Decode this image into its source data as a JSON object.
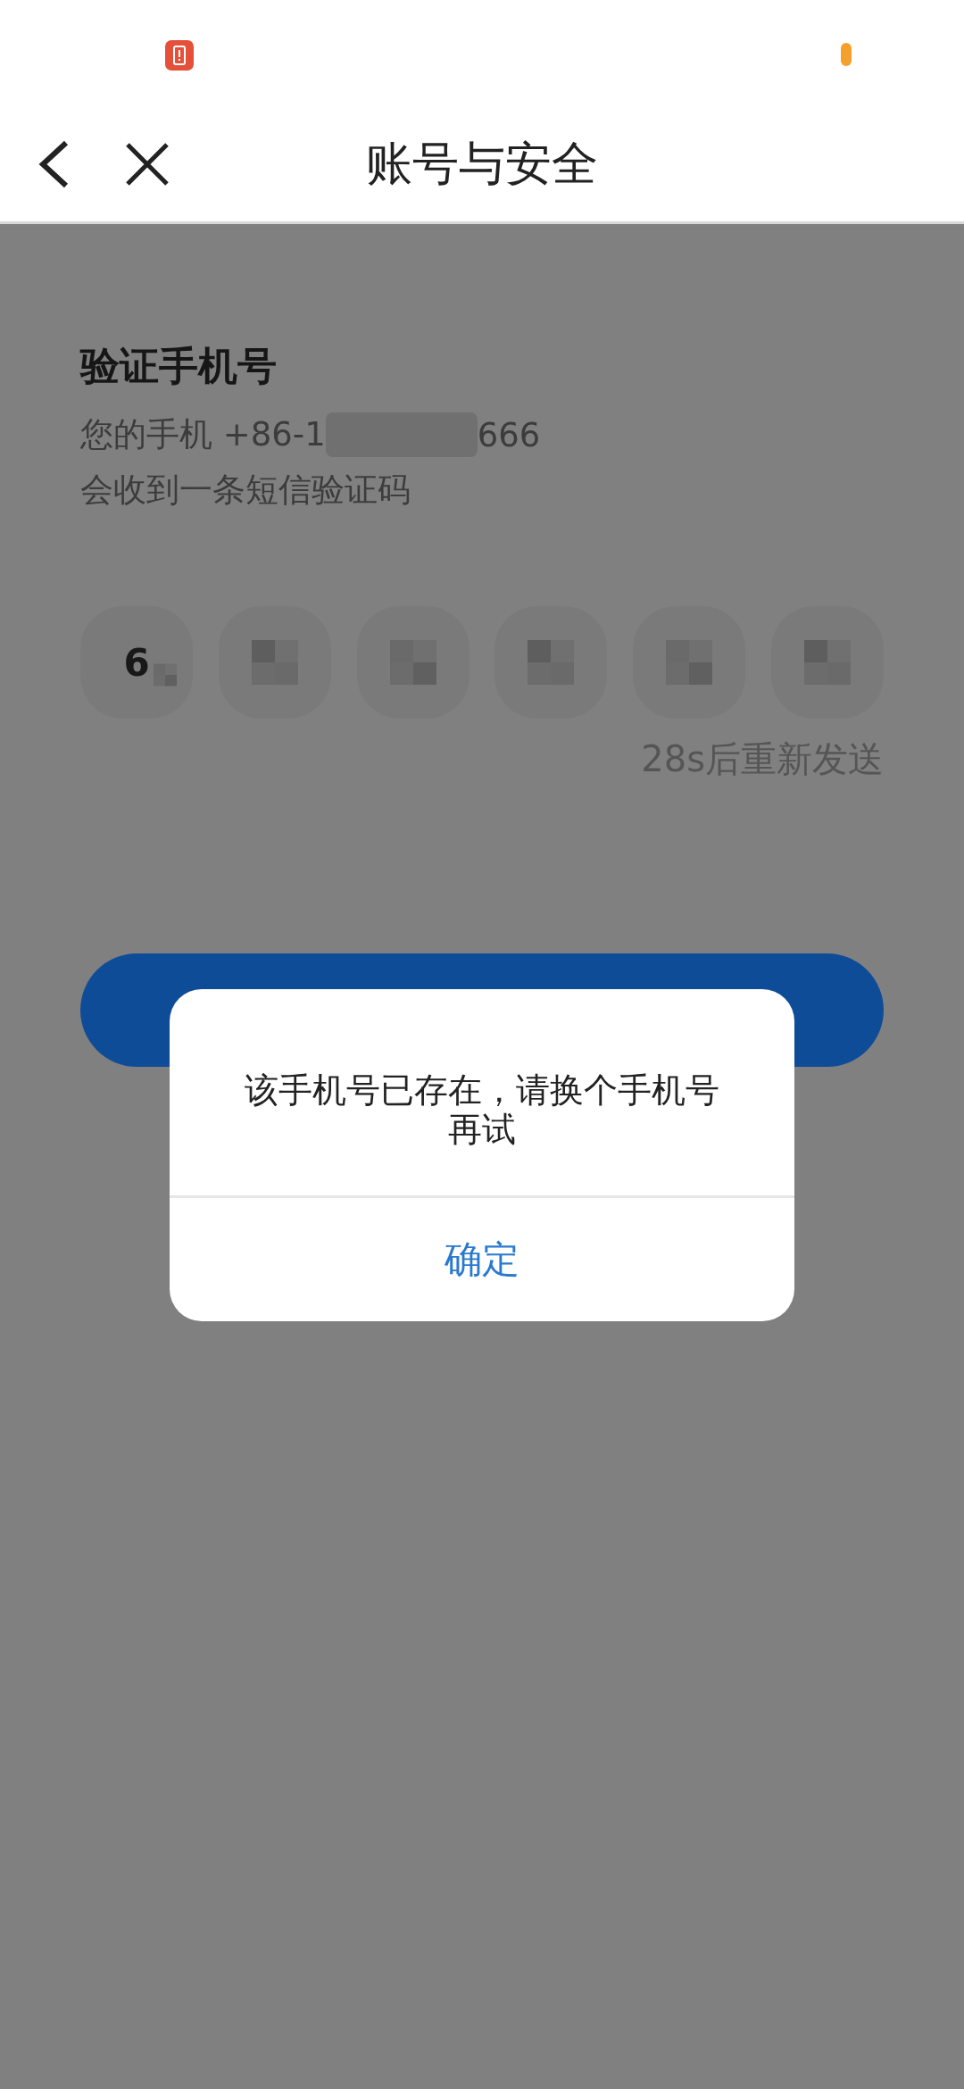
{
  "header": {
    "title": "账号与安全"
  },
  "verify": {
    "title": "验证手机号",
    "phone_prefix": "您的手机 +86-1",
    "phone_suffix": "666",
    "note": "会收到一条短信验证码"
  },
  "code_boxes": [
    {
      "digit": "6",
      "masked": true
    },
    {
      "masked": true
    },
    {
      "masked": true
    },
    {
      "masked": true
    },
    {
      "masked": true
    },
    {
      "masked": true
    }
  ],
  "resend": "28s后重新发送",
  "dialog": {
    "message": "该手机号已存在，请换个手机号再试",
    "confirm": "确定"
  }
}
